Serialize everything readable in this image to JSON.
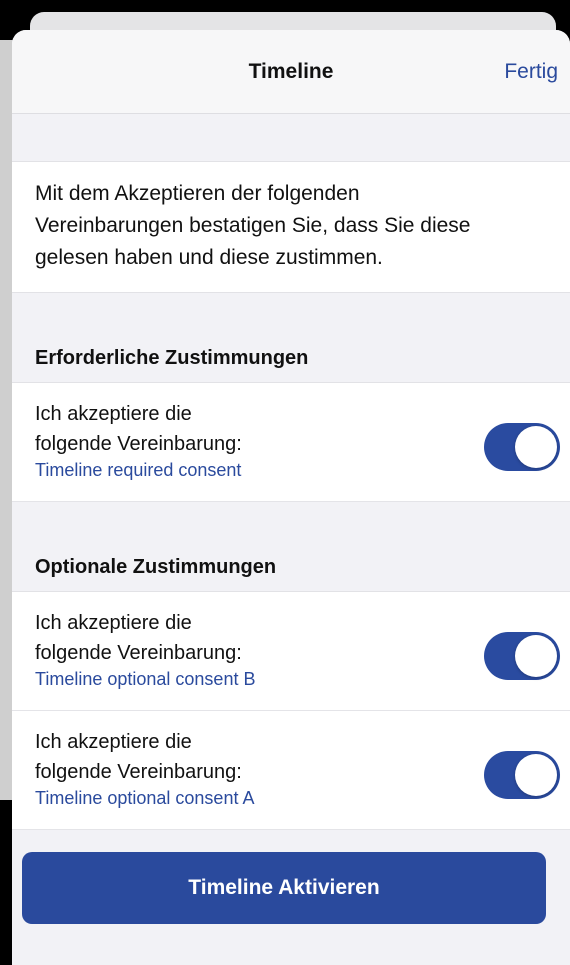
{
  "nav": {
    "title": "Timeline",
    "done_label": "Fertig"
  },
  "intro": {
    "line1": "Mit dem Akzeptieren der folgenden",
    "line2": "Vereinbarungen bestatigen Sie, dass Sie diese",
    "line3": "gelesen haben und diese zustimmen."
  },
  "required": {
    "header": "Erforderliche Zustimmungen",
    "items": [
      {
        "line1": "Ich akzeptiere die",
        "line2": "folgende Vereinbarung:",
        "link": "Timeline required consent",
        "on": true
      }
    ]
  },
  "optional": {
    "header": "Optionale Zustimmungen",
    "items": [
      {
        "line1": "Ich akzeptiere die",
        "line2": "folgende Vereinbarung:",
        "link": "Timeline optional consent B",
        "on": true
      },
      {
        "line1": "Ich akzeptiere die",
        "line2": "folgende Vereinbarung:",
        "link": "Timeline optional consent A",
        "on": true
      }
    ]
  },
  "activate_label": "Timeline Aktivieren",
  "colors": {
    "accent": "#2a4a9d",
    "toggle_on": "#2a4ba0"
  }
}
